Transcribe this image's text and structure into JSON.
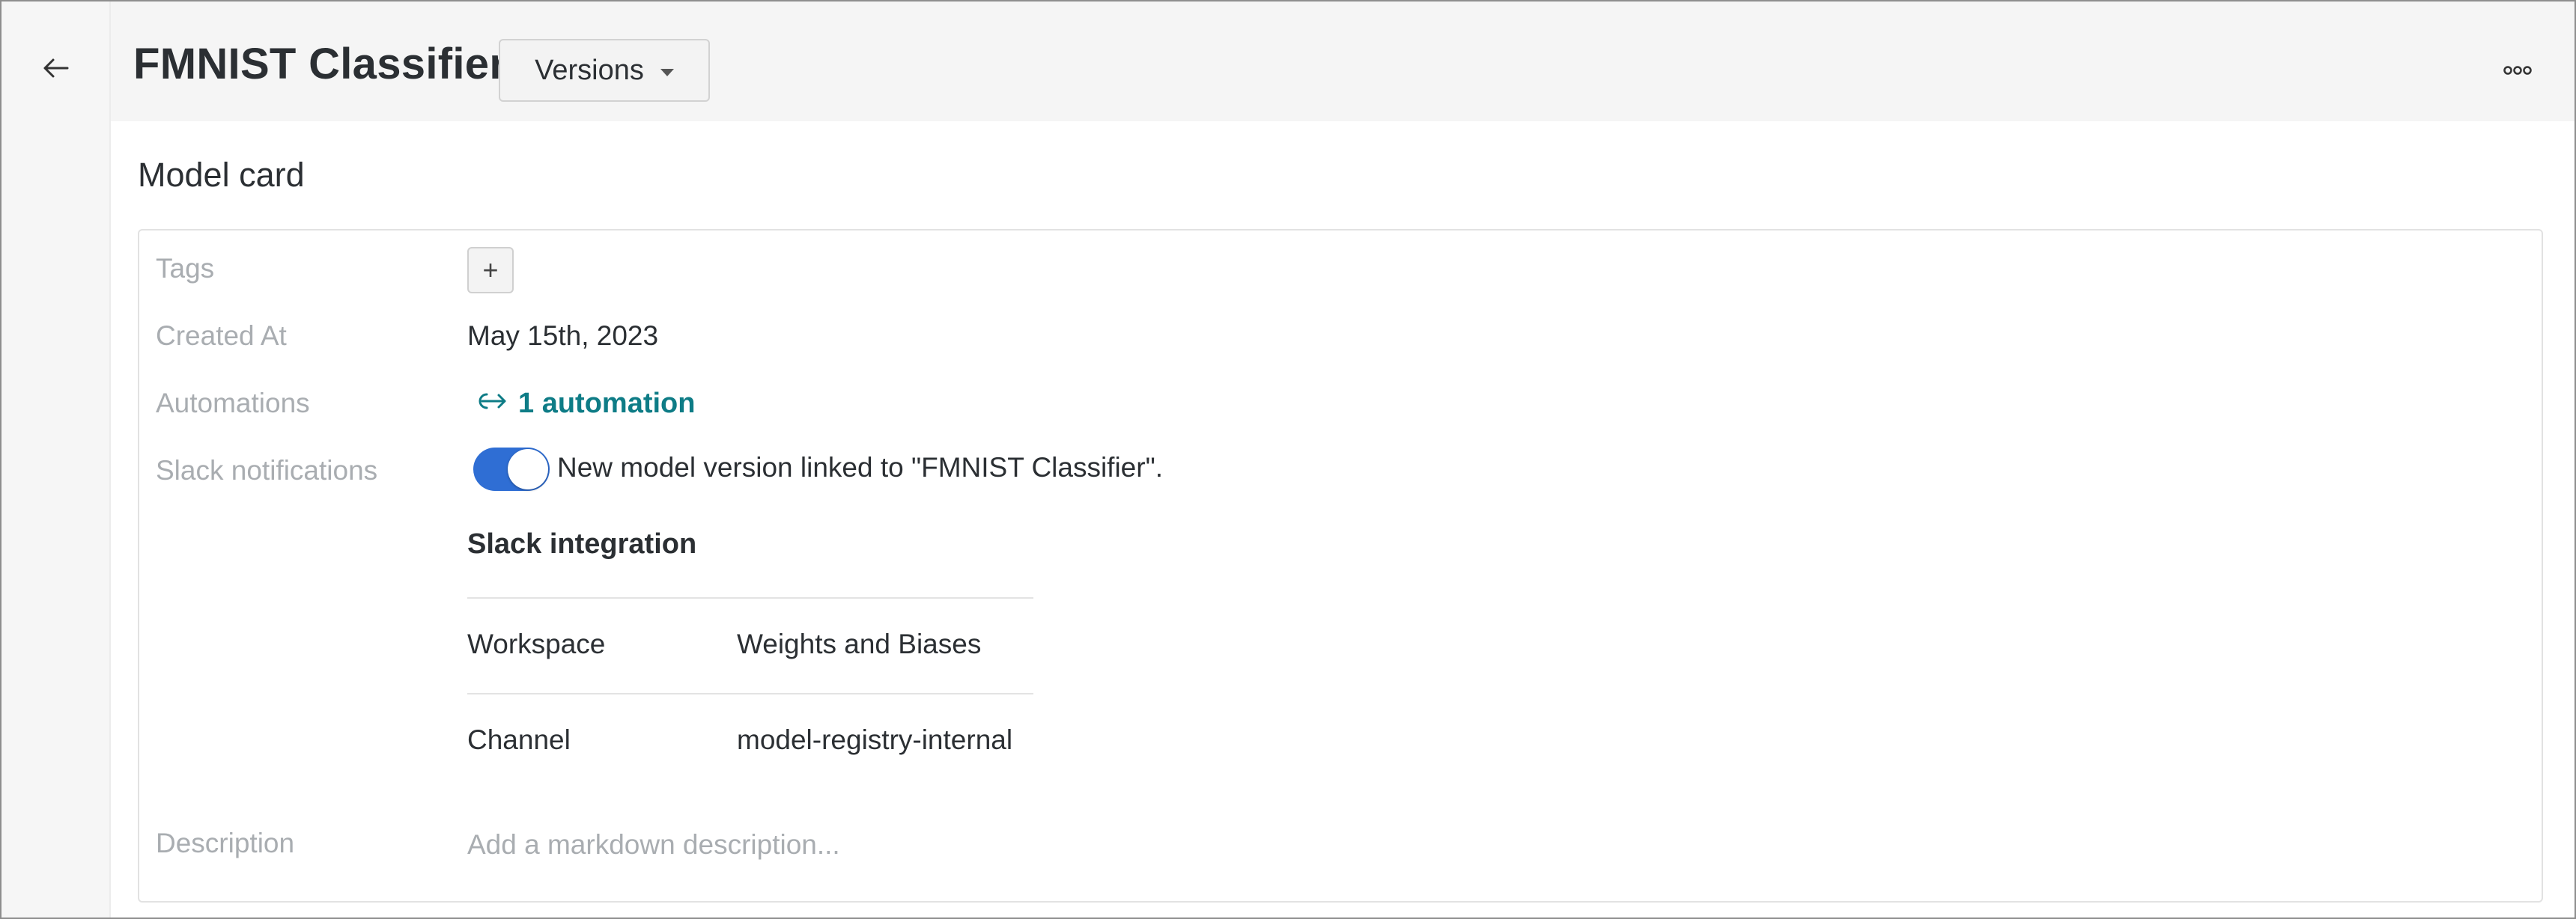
{
  "header": {
    "title": "FMNIST Classifier",
    "versions_label": "Versions"
  },
  "section_title": "Model card",
  "card": {
    "tags_label": "Tags",
    "add_tag_label": "+",
    "created_label": "Created At",
    "created_value": "May 15th, 2023",
    "automations_label": "Automations",
    "automations_value": "1 automation",
    "slack_label": "Slack notifications",
    "slack_toggle_on": true,
    "slack_toggle_text": "New model version linked to \"FMNIST Classifier\".",
    "slack_integration_title": "Slack integration",
    "workspace_label": "Workspace",
    "workspace_value": "Weights and Biases",
    "channel_label": "Channel",
    "channel_value": "model-registry-internal",
    "description_label": "Description",
    "description_placeholder": "Add a markdown description..."
  },
  "colors": {
    "accent_link": "#0e7c86",
    "toggle_on": "#2f6ed4",
    "muted_label": "#a9adb1"
  },
  "icons": {
    "back": "arrow-left-icon",
    "more": "more-horizontal-icon",
    "automation": "link-arrow-icon",
    "versions_caret": "caret-down-icon"
  }
}
